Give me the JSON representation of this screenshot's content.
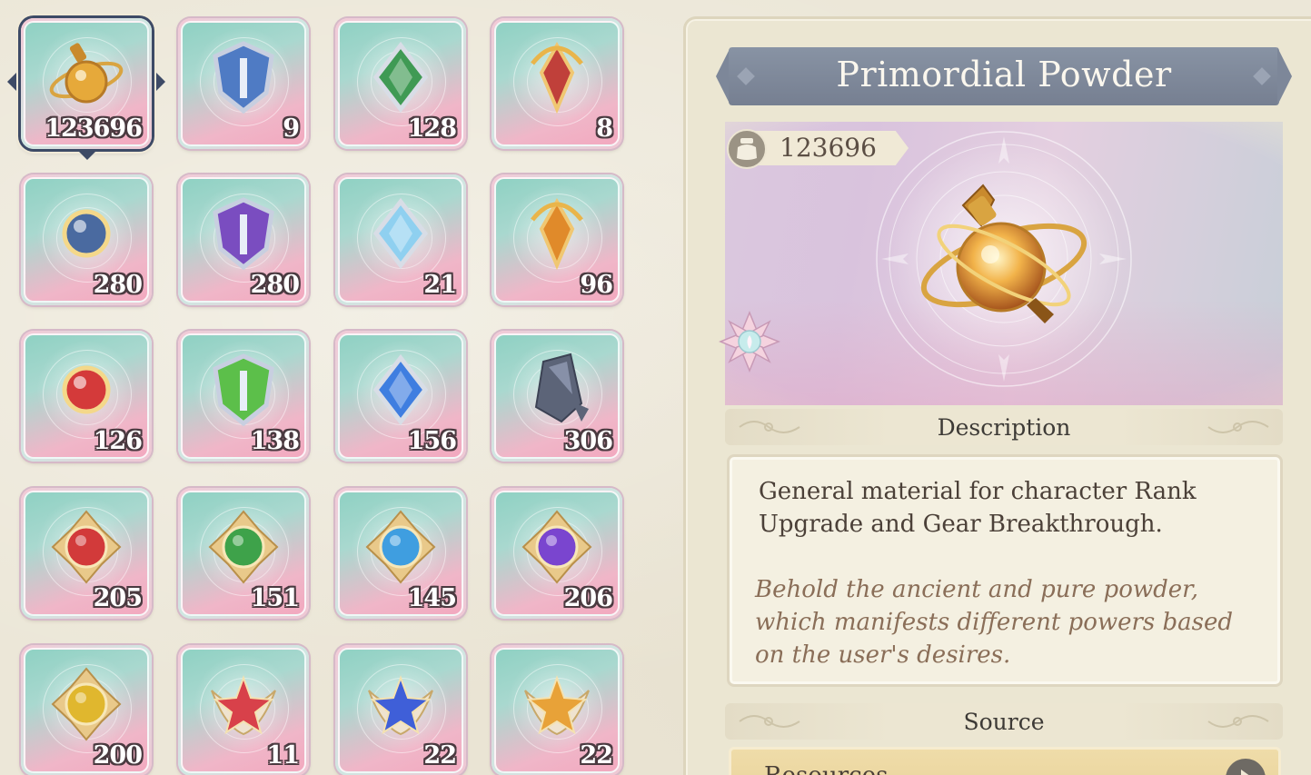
{
  "inventory": {
    "selected_index": 0,
    "items": [
      {
        "count": "123696",
        "icon": "primordial-powder-flask-icon",
        "hue": "#e6a93a"
      },
      {
        "count": "9",
        "icon": "shield-axe-icon",
        "hue": "#4f7bc4"
      },
      {
        "count": "128",
        "icon": "green-crest-icon",
        "hue": "#3f9a54"
      },
      {
        "count": "8",
        "icon": "red-sword-crest-icon",
        "hue": "#c0403a"
      },
      {
        "count": "280",
        "icon": "spellbook-icon",
        "hue": "#4a6aa0"
      },
      {
        "count": "280",
        "icon": "purple-star-crystal-icon",
        "hue": "#7a4dc0"
      },
      {
        "count": "21",
        "icon": "crystal-orb-icon",
        "hue": "#8fd0f0"
      },
      {
        "count": "96",
        "icon": "amber-flame-gem-icon",
        "hue": "#e08a2a"
      },
      {
        "count": "126",
        "icon": "red-crystal-icon",
        "hue": "#d43a3a"
      },
      {
        "count": "138",
        "icon": "green-crystal-icon",
        "hue": "#5cbf4a"
      },
      {
        "count": "156",
        "icon": "blue-crystal-icon",
        "hue": "#3f7ee0"
      },
      {
        "count": "306",
        "icon": "dark-ore-icon",
        "hue": "#5c6478"
      },
      {
        "count": "205",
        "icon": "red-gem-emblem-icon",
        "hue": "#d23a3a"
      },
      {
        "count": "151",
        "icon": "green-gem-emblem-icon",
        "hue": "#3ea24a"
      },
      {
        "count": "145",
        "icon": "blue-gem-emblem-icon",
        "hue": "#3f9ee0"
      },
      {
        "count": "206",
        "icon": "purple-gem-emblem-icon",
        "hue": "#7a45cf"
      },
      {
        "count": "200",
        "icon": "gold-gem-emblem-icon",
        "hue": "#e0b72e"
      },
      {
        "count": "11",
        "icon": "red-star-wings-icon",
        "hue": "#d8414a"
      },
      {
        "count": "22",
        "icon": "blue-star-wings-icon",
        "hue": "#3f5fd8"
      },
      {
        "count": "22",
        "icon": "gold-star-wings-icon",
        "hue": "#e8a238"
      }
    ]
  },
  "detail": {
    "title": "Primordial Powder",
    "quantity": "123696",
    "quantity_icon": "pouch-icon",
    "rarity_icon": "lotus-rarity-icon",
    "description_header": "Description",
    "description": "General material for character Rank Upgrade and Gear Breakthrough.",
    "lore": "Behold the ancient and pure powder, which manifests different powers based on the user's desires.",
    "source_header": "Source",
    "source_entry": "Resources",
    "source_go_icon": "arrow-right-icon"
  },
  "colors": {
    "banner": "#7d8799",
    "accent_dark": "#3d4a66",
    "lore_text": "#8a6e58"
  }
}
